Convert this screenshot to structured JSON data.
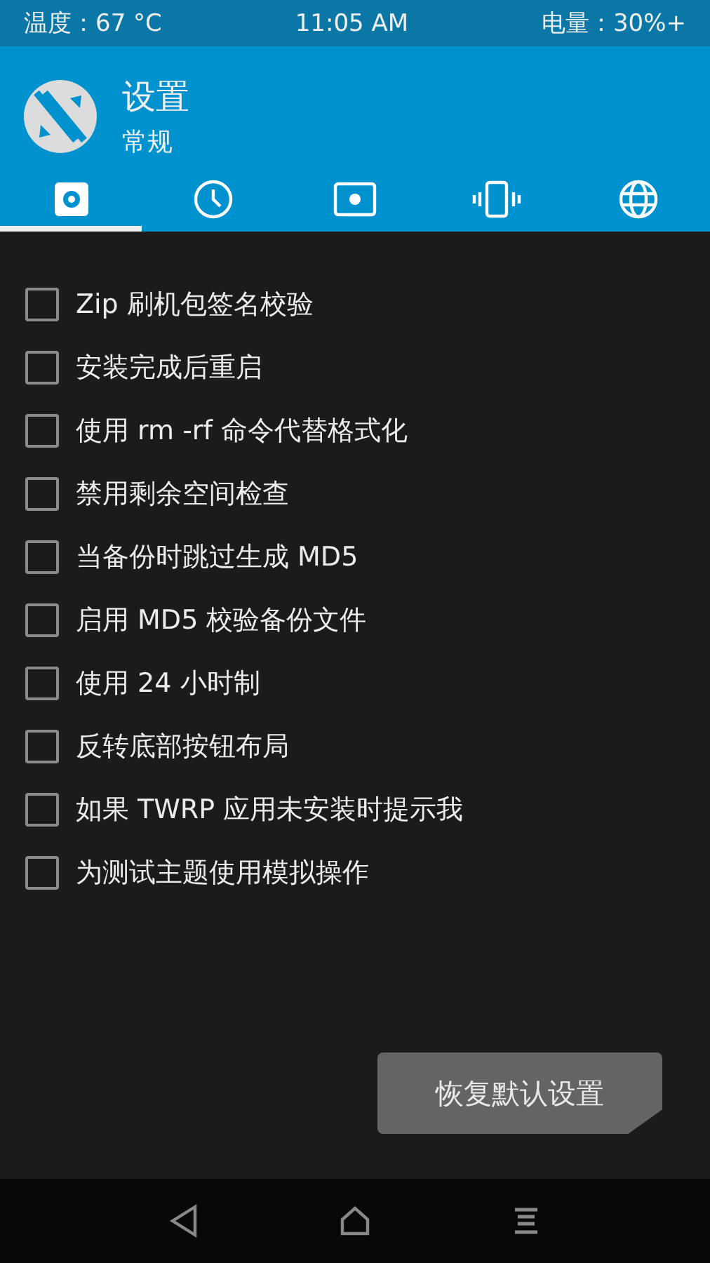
{
  "status_bar": {
    "temperature": "温度：67 °C",
    "time": "11:05 AM",
    "battery": "电量：30%+"
  },
  "header": {
    "title": "设置",
    "subtitle": "常规"
  },
  "tabs": [
    {
      "selected": true
    },
    {
      "selected": false
    },
    {
      "selected": false
    },
    {
      "selected": false
    },
    {
      "selected": false
    }
  ],
  "options": [
    {
      "label": "Zip 刷机包签名校验",
      "checked": false
    },
    {
      "label": "安装完成后重启",
      "checked": false
    },
    {
      "label": "使用 rm -rf 命令代替格式化",
      "checked": false
    },
    {
      "label": "禁用剩余空间检查",
      "checked": false
    },
    {
      "label": "当备份时跳过生成 MD5",
      "checked": false
    },
    {
      "label": "启用 MD5 校验备份文件",
      "checked": false
    },
    {
      "label": "使用 24 小时制",
      "checked": false
    },
    {
      "label": "反转底部按钮布局",
      "checked": false
    },
    {
      "label": "如果 TWRP 应用未安装时提示我",
      "checked": false
    },
    {
      "label": "为测试主题使用模拟操作",
      "checked": false
    }
  ],
  "button": {
    "label": "恢复默认设置"
  }
}
